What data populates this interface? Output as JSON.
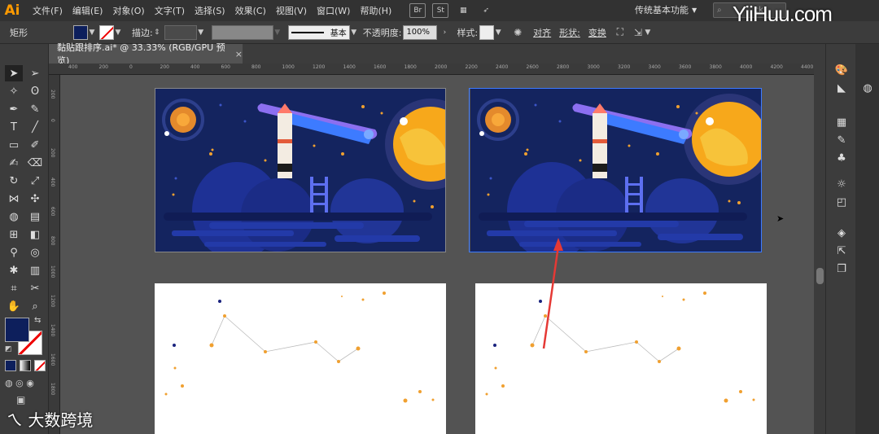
{
  "app": {
    "logo": "Ai"
  },
  "menu": [
    "文件(F)",
    "编辑(E)",
    "对象(O)",
    "文字(T)",
    "选择(S)",
    "效果(C)",
    "视图(V)",
    "窗口(W)",
    "帮助(H)"
  ],
  "menubar_icons": {
    "bridge": "Br",
    "stock": "St"
  },
  "workspace": "传统基本功能",
  "search_placeholder": "ck",
  "watermark": "YiiHuu.com",
  "controlbar": {
    "object_type": "矩形",
    "fill_color": "#0d1f5c",
    "stroke_label": "描边:",
    "stroke_style": "基本",
    "opacity_label": "不透明度:",
    "opacity_value": "100%",
    "style_label": "样式:",
    "align_label": "对齐",
    "shape_label": "形状:",
    "transform_label": "变换"
  },
  "document_tab": {
    "title": "黏贴跟排序.ai* @ 33.33% (RGB/GPU 预览)",
    "close": "×"
  },
  "ruler_top": [
    "400",
    "200",
    "0",
    "200",
    "400",
    "600",
    "800",
    "1000",
    "1200",
    "1400",
    "1600",
    "1800",
    "2000",
    "2200",
    "2400",
    "2600",
    "2800",
    "3000",
    "3200",
    "3400",
    "3600",
    "3800",
    "4000",
    "4200",
    "4400"
  ],
  "ruler_left": [
    "200",
    "0",
    "200",
    "400",
    "600",
    "800",
    "1000",
    "1200",
    "1400",
    "1600",
    "1800",
    "2000",
    "2200"
  ],
  "bottom_logo": "大数跨境",
  "colors": {
    "illustration_bg": "#14245f",
    "moon": "#f7a81b",
    "accent_arrow": "#e53935",
    "selection_blue": "#3d7bff",
    "dot_orange": "#f0a030",
    "dot_navy": "#1a237e"
  }
}
